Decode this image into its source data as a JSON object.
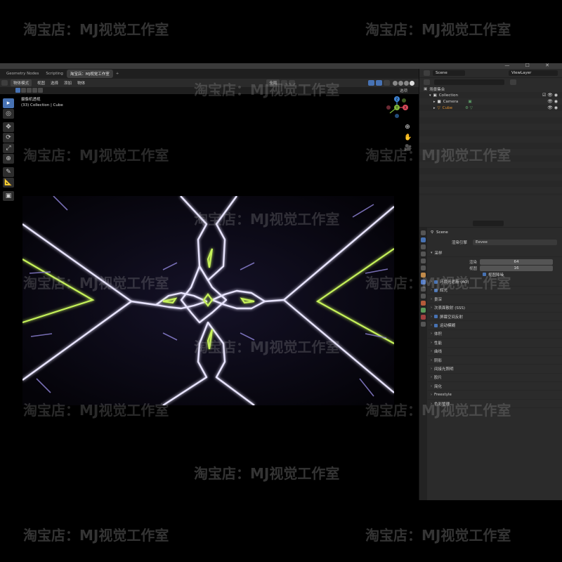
{
  "watermark": "淘宝店：MJ视觉工作室",
  "window": {
    "controls": "— ☐ ✕"
  },
  "workspace_tabs": [
    "Geometry Nodes",
    "Scripting",
    "淘宝店：MJ视觉工作室"
  ],
  "workspace_add": "+",
  "viewport_header": {
    "mode": "物体模式",
    "menus": [
      "视图",
      "选择",
      "添加",
      "物体"
    ],
    "transform": "全局"
  },
  "viewport_sub": {
    "options": "选项"
  },
  "viewport_info": {
    "title": "摄像机透视",
    "subtitle": "(33) Collection | Cube"
  },
  "gizmo": {
    "x": "X",
    "y": "Y",
    "z": "Z"
  },
  "tools": [
    "▸",
    "◎",
    "✥",
    "⟳",
    "⤢",
    "⊕",
    "✎",
    "📐",
    "▣"
  ],
  "outliner": {
    "scene_label": "Scene",
    "view_layer": "ViewLayer",
    "root": "场景集合",
    "items": [
      {
        "name": "Collection",
        "color": "#cccccc"
      },
      {
        "name": "Camera",
        "color": "#cccccc"
      },
      {
        "name": "Cube",
        "color": "#e0902c"
      }
    ]
  },
  "properties": {
    "scene": "Scene",
    "engine_label": "渲染引擎",
    "engine": "Eevee",
    "sampling": "采样",
    "render_label": "渲染",
    "render_samples": "64",
    "viewport_label": "视图",
    "viewport_samples": "16",
    "viewport_denoise": "视图降噪",
    "panels": [
      {
        "label": "环境光遮蔽 (AO)",
        "checkbox": true
      },
      {
        "label": "辉光",
        "checkbox": true
      },
      {
        "label": "景深",
        "checkbox": false
      },
      {
        "label": "次表面散射 (SSS)",
        "checkbox": false
      },
      {
        "label": "屏幕空间反射",
        "checkbox": true
      },
      {
        "label": "运动模糊",
        "checkbox": true
      },
      {
        "label": "体积",
        "checkbox": false
      },
      {
        "label": "性能",
        "checkbox": false
      },
      {
        "label": "曲线",
        "checkbox": false
      },
      {
        "label": "阴影",
        "checkbox": false
      },
      {
        "label": "间接光照明",
        "checkbox": false
      },
      {
        "label": "胶片",
        "checkbox": false
      },
      {
        "label": "简化",
        "checkbox": false
      },
      {
        "label": "Freestyle",
        "checkbox": false
      },
      {
        "label": "色彩管理",
        "checkbox": false
      }
    ]
  },
  "colors": {
    "accent": "#4772b3",
    "line_white": "#e8e4ff",
    "line_green": "#c6f25a",
    "line_purple": "#8a7fd0"
  }
}
